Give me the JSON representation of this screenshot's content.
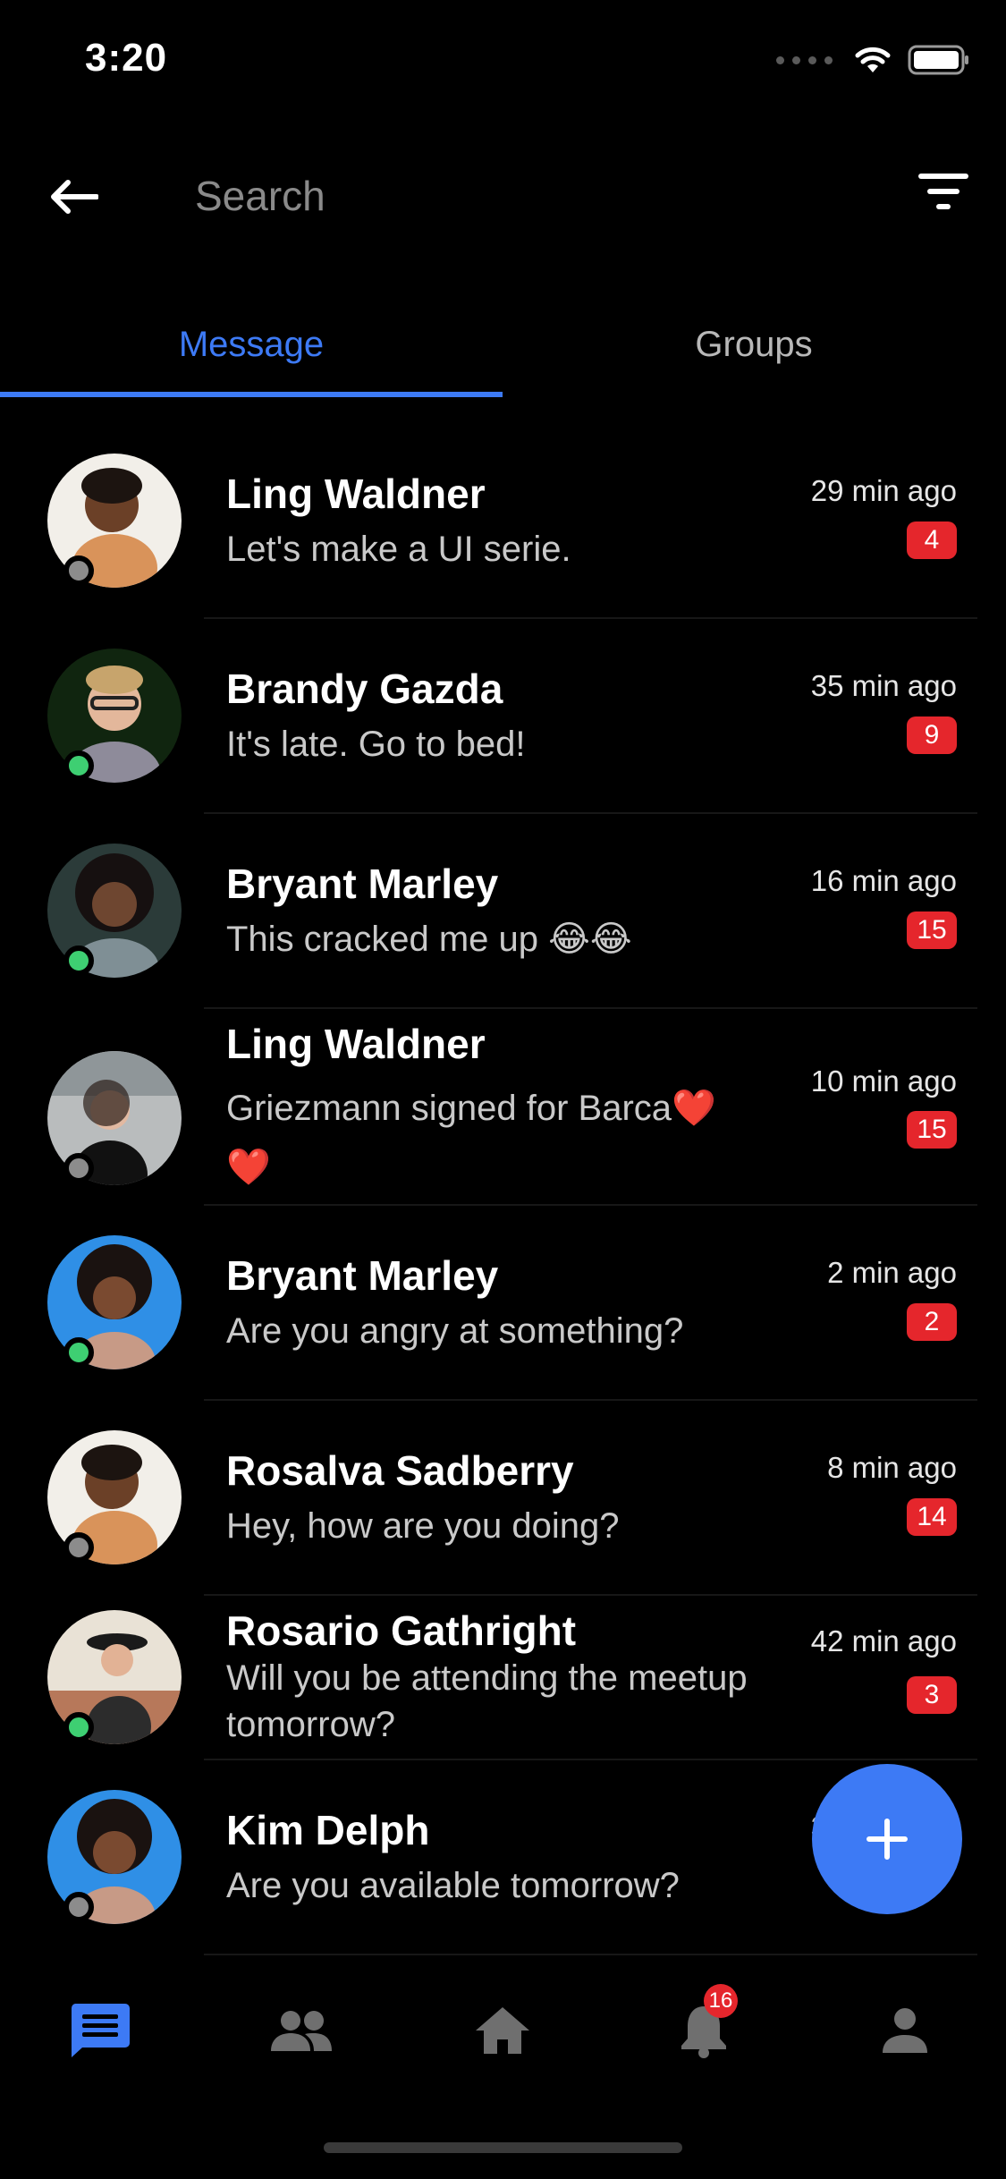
{
  "status_bar": {
    "time": "3:20"
  },
  "header": {
    "search_placeholder": "Search"
  },
  "tabs": [
    {
      "label": "Message",
      "active": true
    },
    {
      "label": "Groups",
      "active": false
    }
  ],
  "conversations": [
    {
      "name": "Ling Waldner",
      "message": "Let's make a UI serie.",
      "time": "29 min ago",
      "unread": "4",
      "online": false
    },
    {
      "name": "Brandy Gazda",
      "message": "It's late. Go to bed!",
      "time": "35 min ago",
      "unread": "9",
      "online": true
    },
    {
      "name": "Bryant Marley",
      "message": "This cracked me up 😂😂",
      "time": "16 min ago",
      "unread": "15",
      "online": true
    },
    {
      "name": "Ling Waldner",
      "message": "Griezmann signed for Barca❤️ ❤️",
      "time": "10 min ago",
      "unread": "15",
      "online": false
    },
    {
      "name": "Bryant Marley",
      "message": "Are you angry at something?",
      "time": "2 min ago",
      "unread": "2",
      "online": true
    },
    {
      "name": "Rosalva Sadberry",
      "message": "Hey, how are you doing?",
      "time": "8 min ago",
      "unread": "14",
      "online": false
    },
    {
      "name": "Rosario Gathright",
      "message": "Will you be attending the meetup tomorrow?",
      "time": "42 min ago",
      "unread": "3",
      "online": true
    },
    {
      "name": "Kim Delph",
      "message": "Are you available tomorrow?",
      "time": "3",
      "unread": "",
      "online": false
    }
  ],
  "bottom_nav": {
    "notifications_count": "16"
  },
  "colors": {
    "accent": "#3d7af5",
    "badge": "#e5262c",
    "online": "#3ecf72",
    "offline": "#8c8c8c",
    "background": "#000000"
  }
}
